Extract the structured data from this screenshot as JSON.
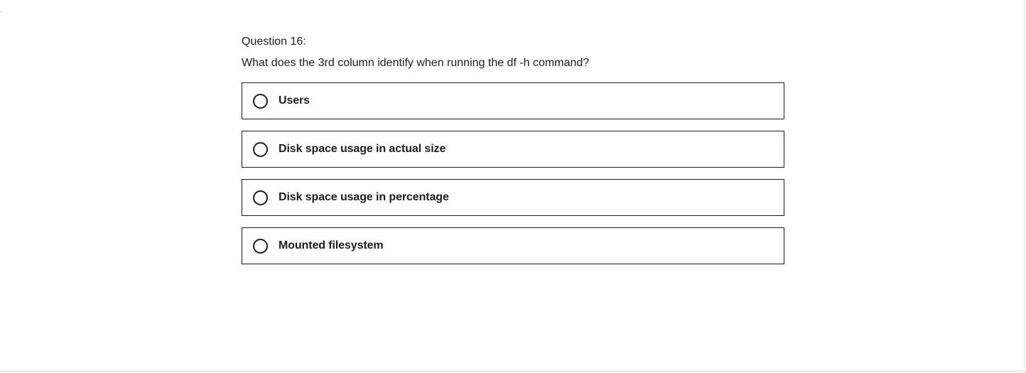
{
  "question": {
    "number_label": "Question 16:",
    "prompt": "What does the 3rd column identify when running the df -h command?"
  },
  "answers": [
    {
      "label": "Users",
      "selected": false
    },
    {
      "label": "Disk space usage in actual size",
      "selected": false
    },
    {
      "label": "Disk space usage in percentage",
      "selected": false
    },
    {
      "label": "Mounted filesystem",
      "selected": false
    }
  ],
  "colors": {
    "text": "#1c1d1f",
    "border": "#1c1d1f",
    "background": "#ffffff"
  }
}
